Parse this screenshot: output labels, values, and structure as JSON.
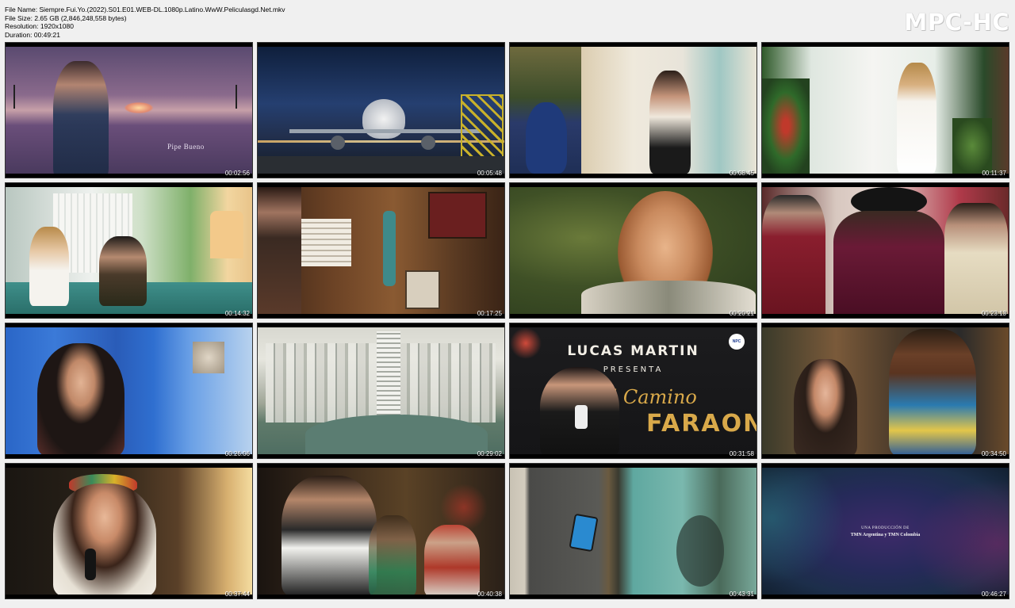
{
  "info": {
    "file_name": "File Name: Siempre.Fui.Yo.(2022).S01.E01.WEB-DL.1080p.Latino.WwW.Peliculasgd.Net.mkv",
    "file_size": "File Size: 2.65 GB (2,846,248,558 bytes)",
    "resolution": "Resolution: 1920x1080",
    "duration": "Duration: 00:49:21"
  },
  "logo": "MPC-HC",
  "thumbnails": [
    {
      "time": "00:02:56",
      "caption": "Pipe Bueno"
    },
    {
      "time": "00:05:48"
    },
    {
      "time": "00:08:45"
    },
    {
      "time": "00:11:37"
    },
    {
      "time": "00:14:32"
    },
    {
      "time": "00:17:25"
    },
    {
      "time": "00:20:21"
    },
    {
      "time": "00:23:13"
    },
    {
      "time": "00:26:06"
    },
    {
      "time": "00:29:02"
    },
    {
      "time": "00:31:58",
      "sign_line1": "LUCAS MARTIN",
      "sign_line2": "PRESENTA",
      "sign_line3": "El Camino",
      "sign_line4": "FARAON",
      "badge": "NPC"
    },
    {
      "time": "00:34:50"
    },
    {
      "time": "00:37:44"
    },
    {
      "time": "00:40:38"
    },
    {
      "time": "00:43:31"
    },
    {
      "time": "00:46:27",
      "credit_line1": "UNA PRODUCCIÓN DE",
      "credit_line2": "TMN Argentina y TMN Colombia"
    }
  ]
}
